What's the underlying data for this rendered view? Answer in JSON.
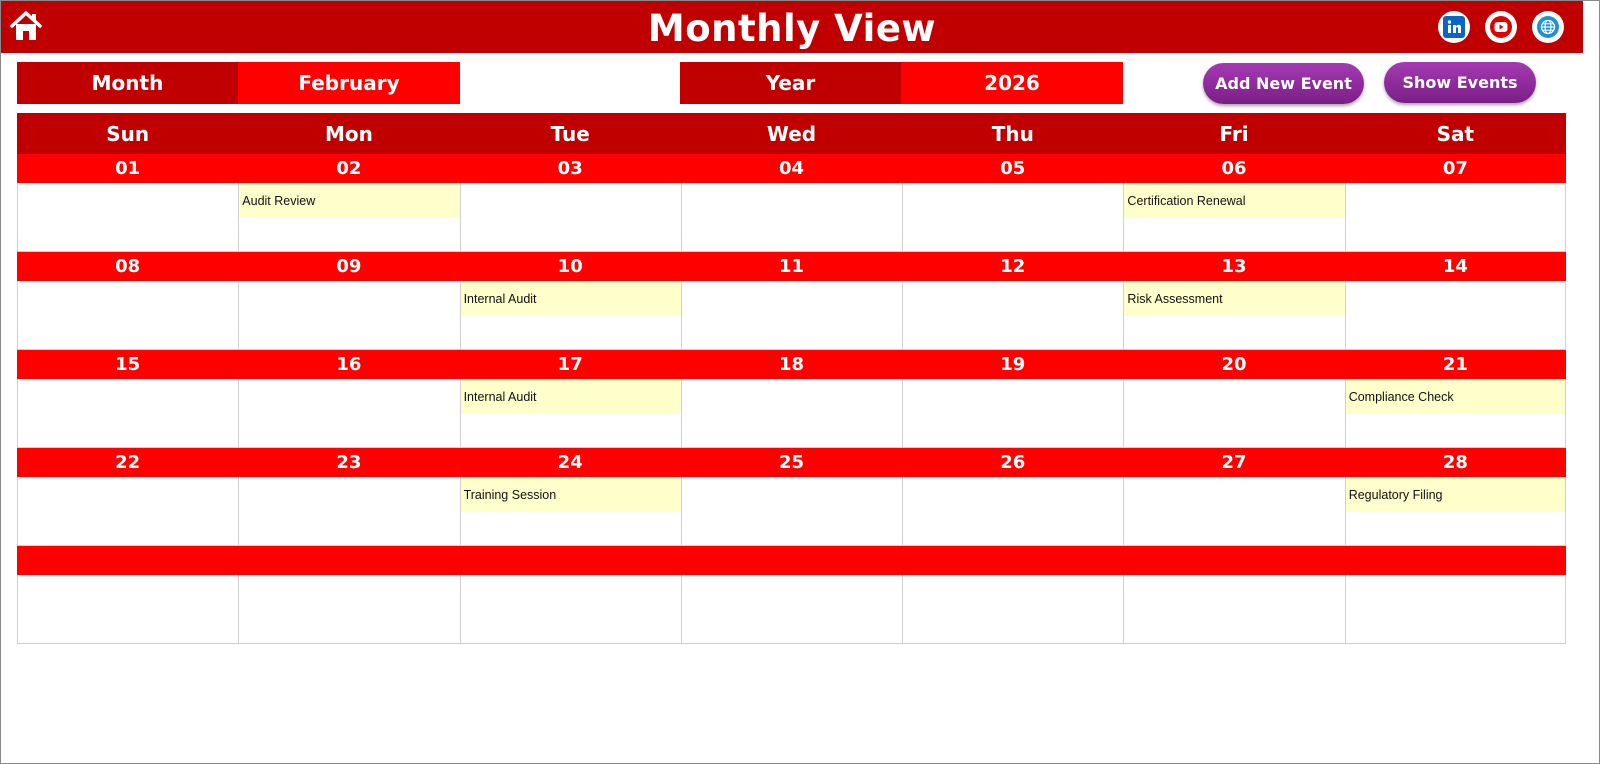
{
  "header": {
    "title": "Monthly View",
    "icons": [
      "home-icon",
      "linkedin-icon",
      "youtube-icon",
      "globe-icon"
    ]
  },
  "selectors": {
    "month_label": "Month",
    "month_value": "February",
    "year_label": "Year",
    "year_value": "2026"
  },
  "buttons": {
    "add_event": "Add New Event",
    "show_events": "Show Events"
  },
  "calendar": {
    "days": [
      "Sun",
      "Mon",
      "Tue",
      "Wed",
      "Thu",
      "Fri",
      "Sat"
    ],
    "weeks": [
      {
        "dates": [
          "01",
          "02",
          "03",
          "04",
          "05",
          "06",
          "07"
        ],
        "events": [
          "",
          "Audit Review",
          "",
          "",
          "",
          "Certification Renewal",
          ""
        ]
      },
      {
        "dates": [
          "08",
          "09",
          "10",
          "11",
          "12",
          "13",
          "14"
        ],
        "events": [
          "",
          "",
          "Internal Audit",
          "",
          "",
          "Risk Assessment",
          ""
        ]
      },
      {
        "dates": [
          "15",
          "16",
          "17",
          "18",
          "19",
          "20",
          "21"
        ],
        "events": [
          "",
          "",
          "Internal Audit",
          "",
          "",
          "",
          "Compliance Check"
        ]
      },
      {
        "dates": [
          "22",
          "23",
          "24",
          "25",
          "26",
          "27",
          "28"
        ],
        "events": [
          "",
          "",
          "Training Session",
          "",
          "",
          "",
          "Regulatory Filing"
        ]
      },
      {
        "dates": [
          "",
          "",
          "",
          "",
          "",
          "",
          ""
        ],
        "events": [
          "",
          "",
          "",
          "",
          "",
          "",
          ""
        ]
      }
    ]
  },
  "colors": {
    "header_red": "#c00000",
    "bright_red": "#ff0000",
    "event_fill": "#ffffcc",
    "button_purple": "#8e2a9c"
  }
}
